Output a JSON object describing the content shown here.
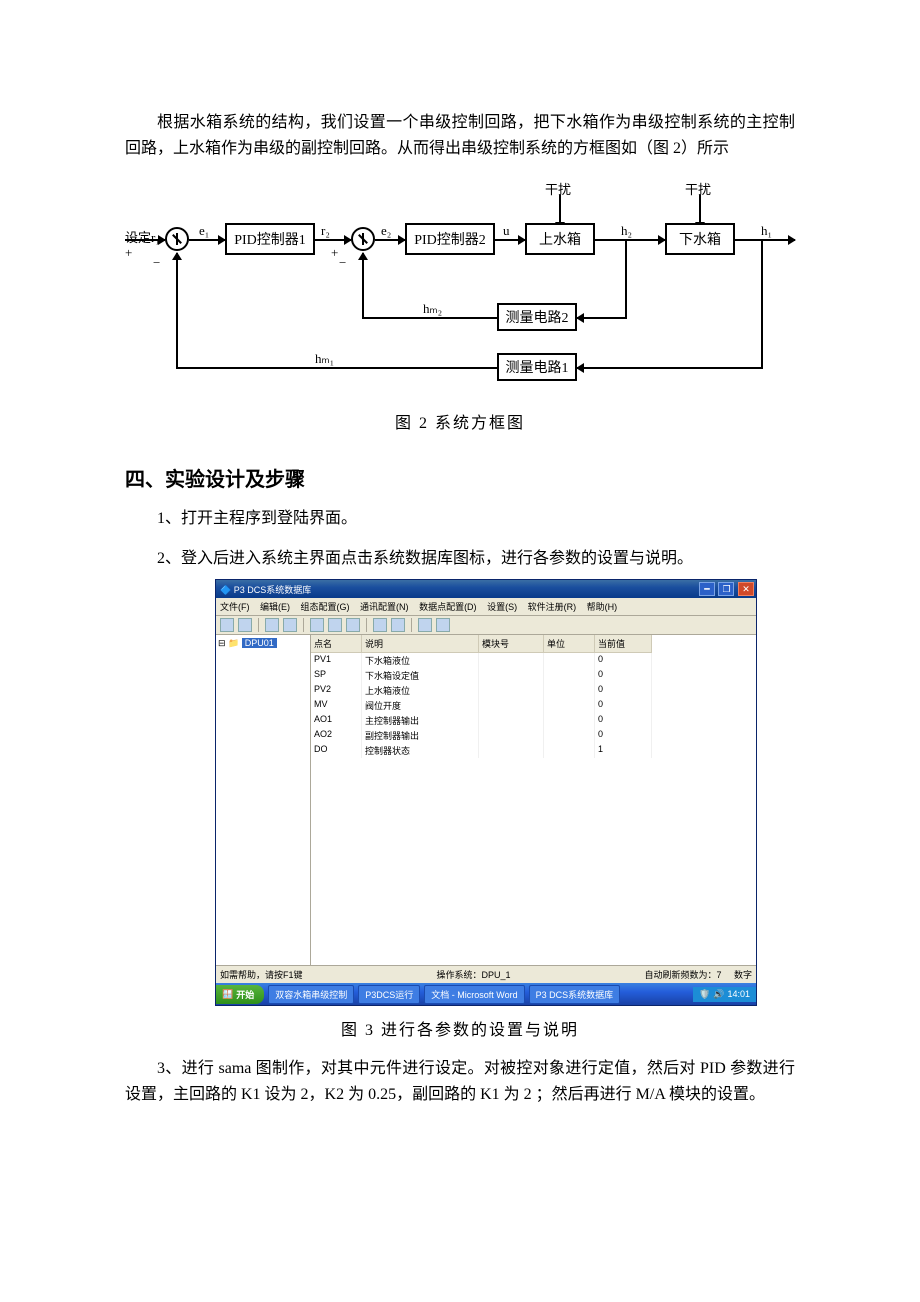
{
  "intro_para": "根据水箱系统的结构，我们设置一个串级控制回路，把下水箱作为串级控制系统的主控制回路，上水箱作为串级的副控制回路。从而得出串级控制系统的方框图如（图 2）所示",
  "diagram": {
    "input": "设定r₁",
    "e1": "e₁",
    "pid1": "PID控制器1",
    "r2": "r₂",
    "e2": "e₂",
    "pid2": "PID控制器2",
    "u": "u",
    "plant1": "上水箱",
    "h2": "h₂",
    "plant2": "下水箱",
    "h1": "h₁",
    "disturb": "干扰",
    "meas1": "测量电路1",
    "meas2": "测量电路2",
    "hm1": "hₘ₁",
    "hm2": "hₘ₂",
    "plus": "+",
    "minus": "−"
  },
  "fig2_caption": "图 2   系统方框图",
  "section_heading": "四、实验设计及步骤",
  "step1": "1、打开主程序到登陆界面。",
  "step2": "2、登入后进入系统主界面点击系统数据库图标，进行各参数的设置与说明。",
  "fig3_caption": "图 3    进行各参数的设置与说明",
  "step3": "3、进行 sama 图制作，对其中元件进行设定。对被控对象进行定值，然后对 PID 参数进行设置，主回路的 K1 设为 2，K2 为 0.25，副回路的 K1 为 2 ；然后再进行 M/A 模块的设置。",
  "screenshot": {
    "title": "P3 DCS系统数据库",
    "menus": [
      "文件(F)",
      "编辑(E)",
      "组态配置(G)",
      "通讯配置(N)",
      "数据点配置(D)",
      "设置(S)",
      "软件注册(R)",
      "帮助(H)"
    ],
    "tree_root": "DPU01",
    "columns": [
      "点名",
      "说明",
      "模块号",
      "单位",
      "当前值"
    ],
    "rows": [
      {
        "name": "PV1",
        "desc": "下水箱液位",
        "mod": "",
        "unit": "",
        "val": "0"
      },
      {
        "name": "SP",
        "desc": "下水箱设定值",
        "mod": "",
        "unit": "",
        "val": "0"
      },
      {
        "name": "PV2",
        "desc": "上水箱液位",
        "mod": "",
        "unit": "",
        "val": "0"
      },
      {
        "name": "MV",
        "desc": "阀位开度",
        "mod": "",
        "unit": "",
        "val": "0"
      },
      {
        "name": "AO1",
        "desc": "主控制器输出",
        "mod": "",
        "unit": "",
        "val": "0"
      },
      {
        "name": "AO2",
        "desc": "副控制器输出",
        "mod": "",
        "unit": "",
        "val": "0"
      },
      {
        "name": "DO",
        "desc": "控制器状态",
        "mod": "",
        "unit": "",
        "val": "1"
      }
    ],
    "status_left": "如需帮助，请按F1键",
    "status_mid": "操作系统：DPU_1",
    "status_right_a": "自动刷新频数为：7",
    "status_right_b": "数字",
    "start": "开始",
    "tasks": [
      "双容水箱串级控制",
      "P3DCS运行",
      "文档 - Microsoft Word",
      "P3 DCS系统数据库"
    ],
    "clock": "14:01"
  }
}
